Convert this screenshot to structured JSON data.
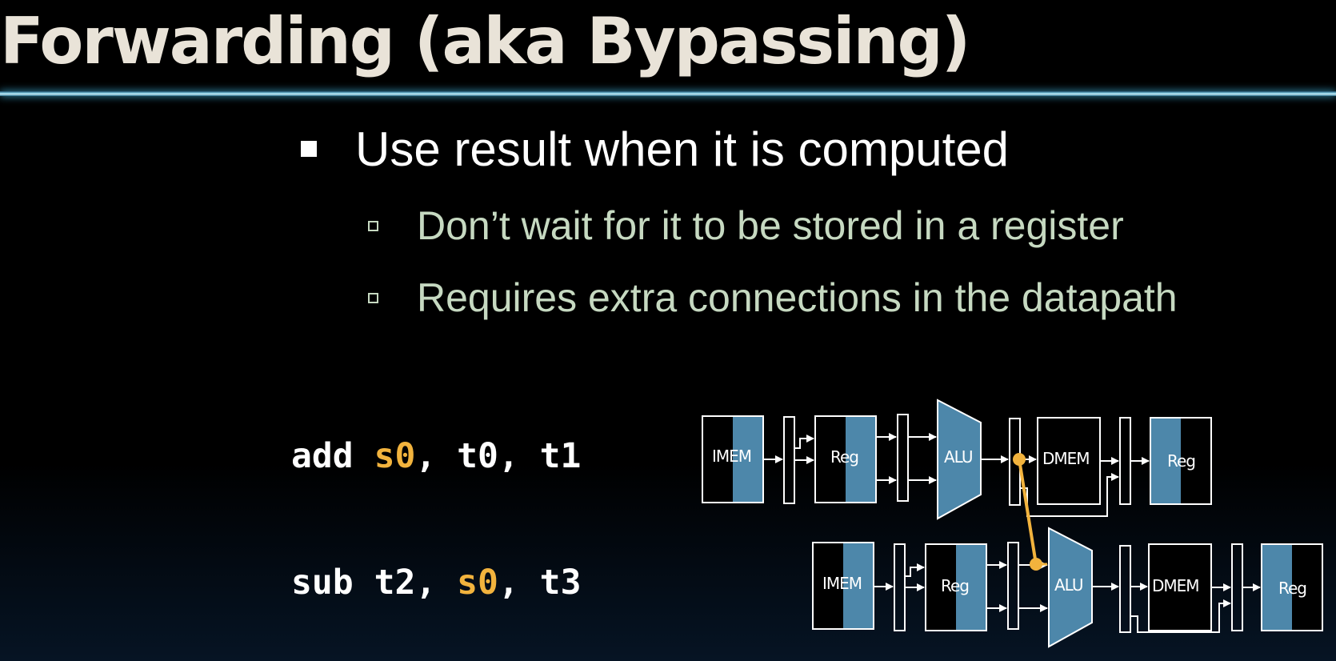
{
  "slide": {
    "title": "Forwarding (aka Bypassing)",
    "bullets": {
      "main": "Use result when it is computed",
      "sub": [
        "Don’t wait for it to be stored in a register",
        "Requires extra connections in the datapath"
      ]
    },
    "code": {
      "line1": {
        "op": "add",
        "dest": "s0",
        "rest": ", t0, t1"
      },
      "line2": {
        "op": "sub",
        "pre": "t2, ",
        "src": "s0",
        "rest": ", t3"
      }
    },
    "pipeline": {
      "stage_labels": [
        "IMEM",
        "Reg",
        "ALU",
        "DMEM",
        "Reg"
      ]
    },
    "colors": {
      "highlight": "#f2b33d",
      "stage_fill": "#4d87aa",
      "title_text": "#e9e3d8",
      "sub_bullet_text": "#c6d9c1"
    }
  }
}
